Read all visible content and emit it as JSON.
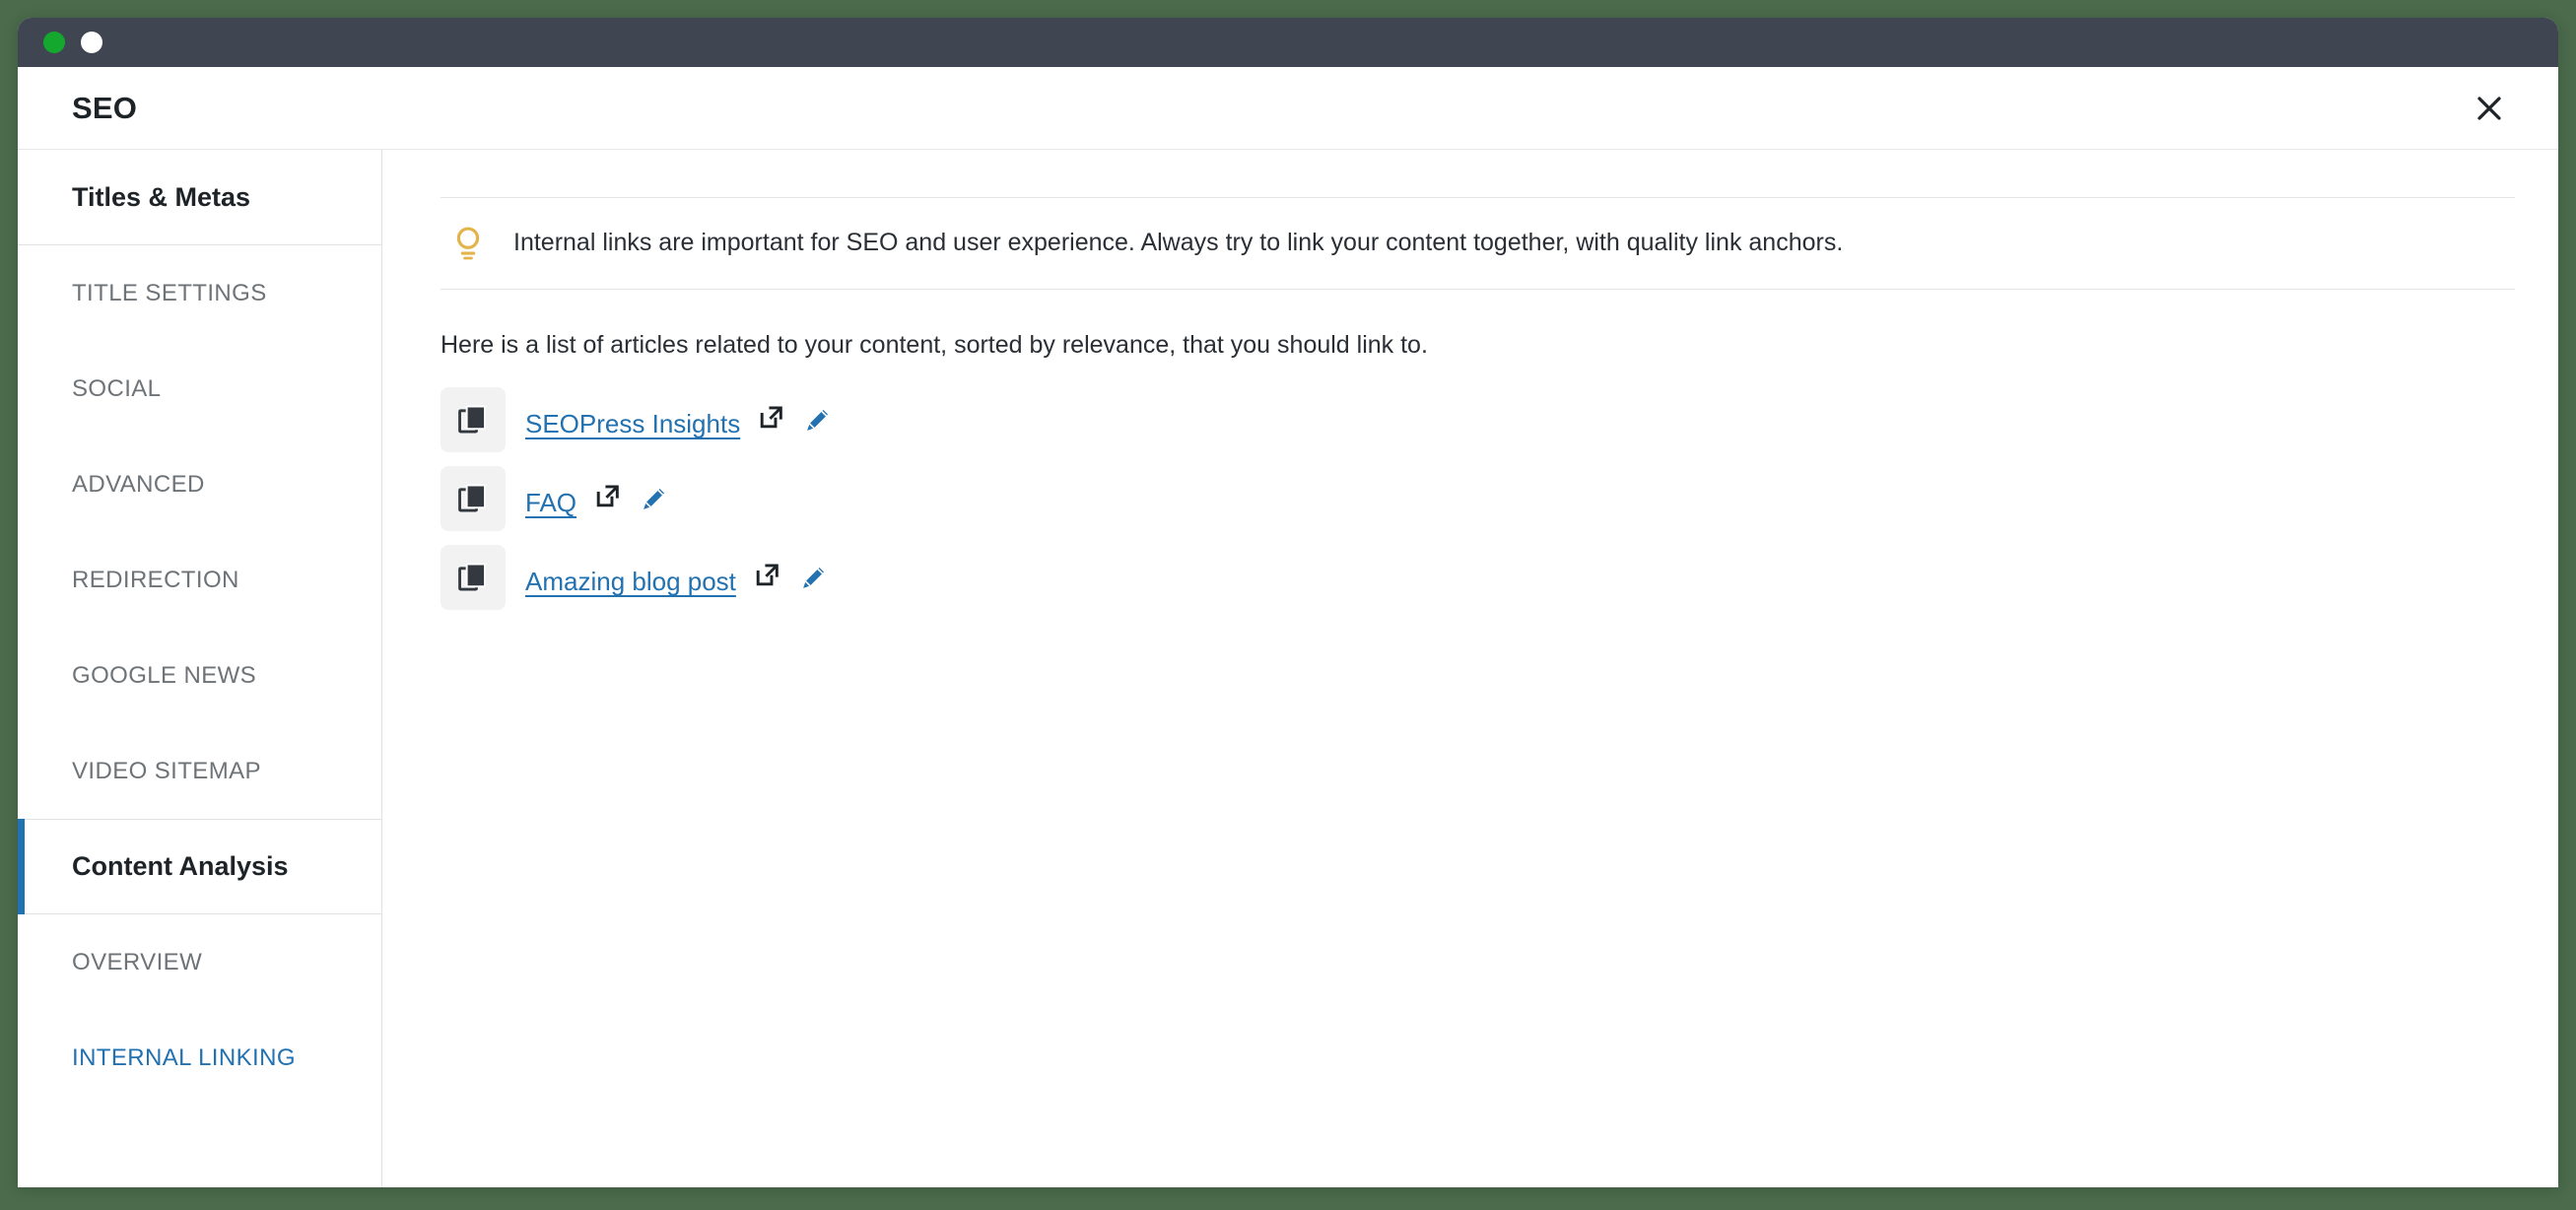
{
  "window": {
    "traffic_lights": [
      {
        "name": "minimize-dot",
        "color": "#15a82f"
      },
      {
        "name": "maximize-dot",
        "color": "#ffffff"
      }
    ],
    "titlebar_color": "#3f4651",
    "background_color": "#4b6b4c"
  },
  "header": {
    "title": "SEO",
    "close_label": "×"
  },
  "sidebar": {
    "items": [
      {
        "label": "Titles & Metas",
        "type": "section",
        "active": false
      },
      {
        "label": "TITLE SETTINGS",
        "type": "link",
        "active": false
      },
      {
        "label": "SOCIAL",
        "type": "link",
        "active": false
      },
      {
        "label": "ADVANCED",
        "type": "link",
        "active": false
      },
      {
        "label": "REDIRECTION",
        "type": "link",
        "active": false
      },
      {
        "label": "GOOGLE NEWS",
        "type": "link",
        "active": false
      },
      {
        "label": "VIDEO SITEMAP",
        "type": "link",
        "active": false
      },
      {
        "label": "Content Analysis",
        "type": "section",
        "active": true
      },
      {
        "label": "OVERVIEW",
        "type": "link",
        "active": false
      },
      {
        "label": "INTERNAL LINKING",
        "type": "link",
        "active": true
      }
    ],
    "accent_color": "#2271b1"
  },
  "main": {
    "tip": {
      "icon": "lightbulb-icon",
      "icon_color": "#e3b44b",
      "text": "Internal links are important for SEO and user experience. Always try to link your content together, with quality link anchors."
    },
    "intro": "Here is a list of articles related to your content, sorted by relevance, that you should link to.",
    "articles": [
      {
        "title": "SEOPress Insights",
        "thumb_icon": "pages-copy-icon",
        "external_icon": "external-link-icon",
        "edit_icon": "pencil-icon"
      },
      {
        "title": "FAQ",
        "thumb_icon": "pages-copy-icon",
        "external_icon": "external-link-icon",
        "edit_icon": "pencil-icon"
      },
      {
        "title": "Amazing blog post",
        "thumb_icon": "pages-copy-icon",
        "external_icon": "external-link-icon",
        "edit_icon": "pencil-icon"
      }
    ],
    "link_color": "#2271b1"
  }
}
